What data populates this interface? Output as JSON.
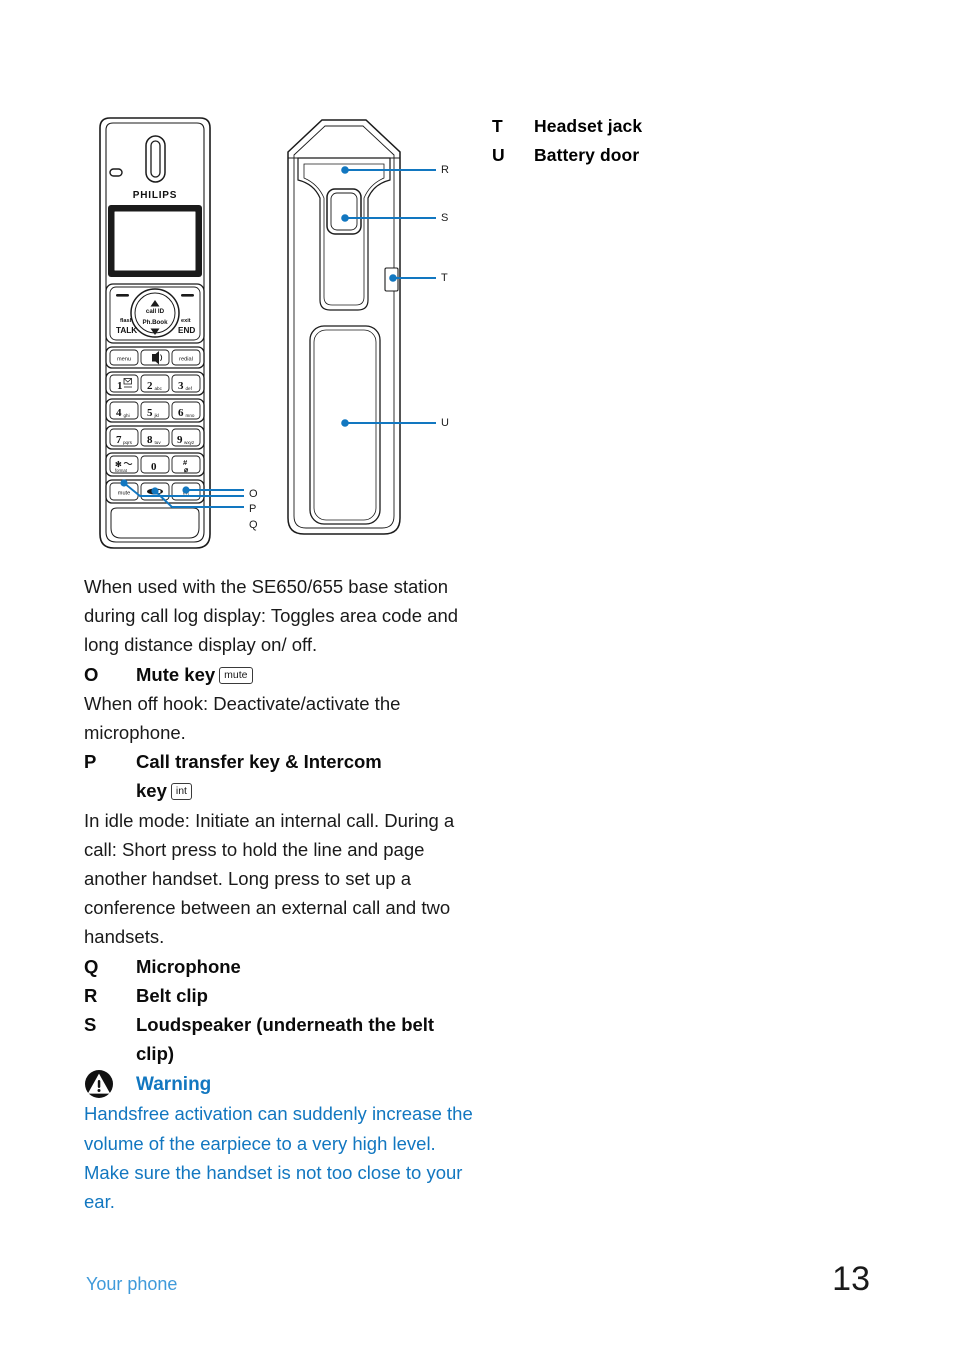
{
  "document": {
    "brand_logo_text": "PHILIPS",
    "accent_color": "#1277c0",
    "text_color": "#1a1a1a"
  },
  "figure": {
    "caption_front_view": "handset-front-view",
    "caption_back_view": "handset-back-view",
    "callouts_left": [
      "O",
      "P",
      "Q"
    ],
    "callouts_right": [
      "R",
      "S",
      "T",
      "U"
    ],
    "handset_keys": {
      "softkey_left": "flash",
      "talk": "TALK",
      "softkey_right": "exit",
      "end": "END",
      "nav_up": "call ID",
      "nav_down": "Ph.Book",
      "row_menu": "menu",
      "row_speaker": "speaker-icon",
      "row_redial": "redial",
      "keypad": [
        [
          {
            "main": "1",
            "sub": "voicemail-icon"
          },
          {
            "main": "2",
            "sub": "abc"
          },
          {
            "main": "3",
            "sub": "def"
          }
        ],
        [
          {
            "main": "4",
            "sub": "ghi"
          },
          {
            "main": "5",
            "sub": "jkl"
          },
          {
            "main": "6",
            "sub": "mno"
          }
        ],
        [
          {
            "main": "7",
            "sub": "pqrs"
          },
          {
            "main": "8",
            "sub": "tuv"
          },
          {
            "main": "9",
            "sub": "wxyz"
          }
        ],
        [
          {
            "main": "*",
            "sub": "format"
          },
          {
            "main": "0",
            "sub": ""
          },
          {
            "main": "#",
            "sub": ""
          }
        ]
      ],
      "bottom_row": [
        "mute",
        "microphone-icon",
        "int"
      ]
    }
  },
  "tu_list": [
    {
      "key": "T",
      "label": "Headset jack"
    },
    {
      "key": "U",
      "label": "Battery door"
    }
  ],
  "body": {
    "intro_paragraph": "When used with the SE650/655 base station during call log display: Toggles area code and long distance display on/ off.",
    "item_o": {
      "key": "O",
      "title": "Mute key",
      "keycap": "mute",
      "description": "When off hook: Deactivate/activate the microphone."
    },
    "item_p": {
      "key": "P",
      "title_line1": "Call transfer key & Intercom",
      "title_line2": "key",
      "keycap": "int",
      "description": "In idle mode: Initiate an internal call. During a call: Short press to hold the line and page another handset. Long press to set up a conference between an external call and two handsets."
    },
    "item_q": {
      "key": "Q",
      "title": "Microphone"
    },
    "item_r": {
      "key": "R",
      "title": "Belt clip"
    },
    "item_s": {
      "key": "S",
      "title": "Loudspeaker (underneath the belt clip)"
    }
  },
  "warning": {
    "icon": "warning-triangle-icon",
    "title": "Warning",
    "text": "Handsfree activation can suddenly increase the volume of the earpiece to a very high level. Make sure the handset is not too close to your ear."
  },
  "footer": {
    "section": "Your phone",
    "page_number": "13"
  }
}
